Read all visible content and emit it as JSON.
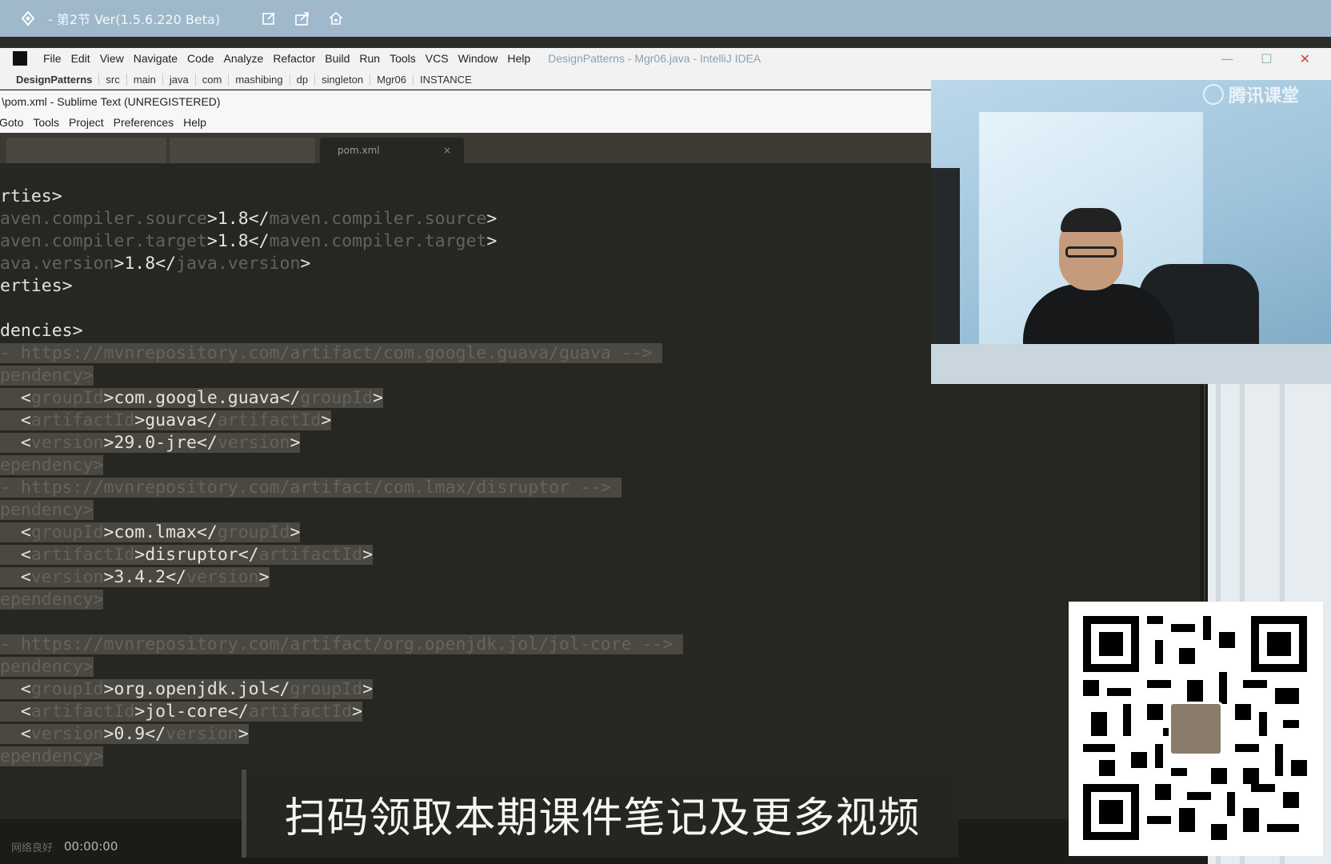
{
  "player": {
    "title": "- 第2节 Ver(1.5.6.220 Beta)"
  },
  "idea": {
    "menu": [
      "File",
      "Edit",
      "View",
      "Navigate",
      "Code",
      "Analyze",
      "Refactor",
      "Build",
      "Run",
      "Tools",
      "VCS",
      "Window",
      "Help"
    ],
    "title": "DesignPatterns - Mgr06.java - IntelliJ IDEA",
    "breadcrumbs": [
      "DesignPatterns",
      "src",
      "main",
      "java",
      "com",
      "mashibing",
      "dp",
      "singleton",
      "Mgr06",
      "INSTANCE"
    ]
  },
  "sublime": {
    "title": "\\pom.xml - Sublime Text (UNREGISTERED)",
    "menu": [
      "Goto",
      "Tools",
      "Project",
      "Preferences",
      "Help"
    ],
    "active_tab": "pom.xml",
    "tab_close": "×"
  },
  "code": {
    "l1": "rties>",
    "l2a": "aven.compiler.source",
    "l2b": ">1.8</",
    "l2c": "maven.compiler.source",
    "l2d": ">",
    "l3a": "aven.compiler.target",
    "l3b": ">1.8</",
    "l3c": "maven.compiler.target",
    "l3d": ">",
    "l4a": "ava.version",
    "l4b": ">1.8</",
    "l4c": "java.version",
    "l4d": ">",
    "l5": "erties>",
    "l6": "dencies>",
    "c1": "- https://mvnrepository.com/artifact/com.google.guava/guava -->",
    "dep_open": "pendency>",
    "g1": ">com.google.guava</",
    "a1": ">guava</",
    "v1": ">29.0-jre</",
    "dep_close": "ependency>",
    "c2": "- https://mvnrepository.com/artifact/com.lmax/disruptor -->",
    "g2": ">com.lmax</",
    "a2": ">disruptor</",
    "v2": ">3.4.2</",
    "c3": "- https://mvnrepository.com/artifact/org.openjdk.jol/jol-core -->",
    "g3": ">org.openjdk.jol</",
    "a3": ">jol-core</",
    "v3": ">0.9</",
    "lt": "<",
    "gt": ">",
    "groupId": "groupId",
    "artifactId": "artifactId",
    "version": "version"
  },
  "webcam": {
    "logo": "腾讯课堂"
  },
  "caption": "扫码领取本期课件笔记及更多视频",
  "status": {
    "network": "网络良好",
    "time": "00:00:00"
  },
  "icons": [
    "app-icon",
    "note-icon",
    "share-icon",
    "home-icon",
    "qr-code"
  ]
}
